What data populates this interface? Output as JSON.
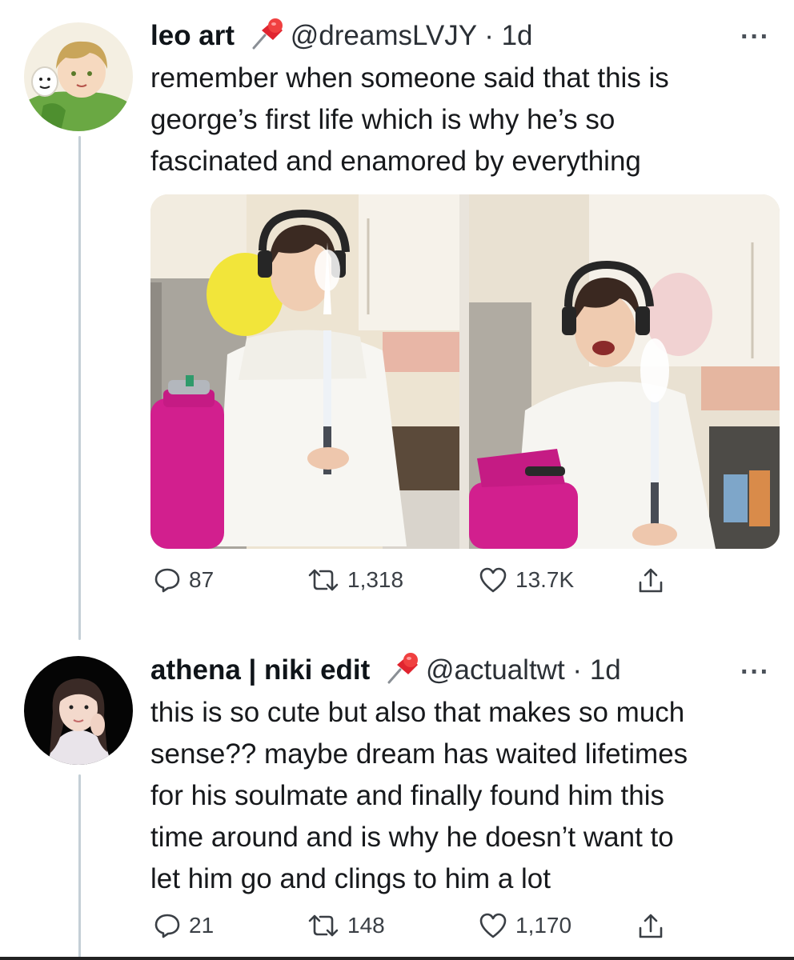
{
  "tweets": [
    {
      "author_name": "leo art",
      "handle": "@dreamsLVJY",
      "separator": "·",
      "time": "1d",
      "more_icon": "···",
      "text": "remember when someone said that this is\ngeorge’s first life which is why he’s so\nfascinated and enamored by everything",
      "media_icons": [
        "birthday-photo-left",
        "birthday-photo-right"
      ],
      "stats": {
        "replies": "87",
        "retweets": "1,318",
        "likes": "13.7K"
      }
    },
    {
      "author_name": "athena | niki edit",
      "handle": "@actualtwt",
      "separator": "·",
      "time": "1d",
      "more_icon": "···",
      "text": "this is so cute but also that makes so much\nsense?? maybe dream has waited lifetimes\nfor his soulmate and finally found him this\ntime around and is why he doesn’t want to\nlet him go and clings to him a lot",
      "stats": {
        "replies": "21",
        "retweets": "148",
        "likes": "1,170"
      }
    }
  ],
  "colors": {
    "text": "#0f1419",
    "secondary": "#3a3f45",
    "thread_line": "#c4cfd6",
    "pin_red": "#e0242f"
  }
}
